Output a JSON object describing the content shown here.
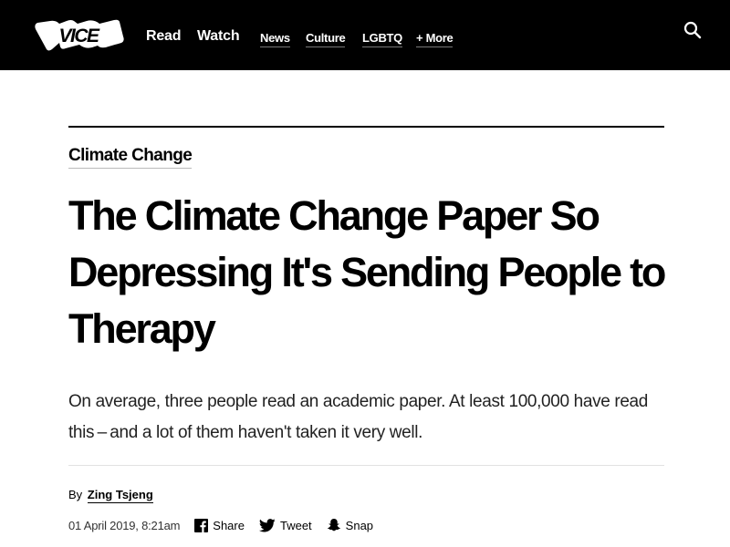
{
  "header": {
    "logo": "VICE",
    "nav_primary": [
      "Read",
      "Watch"
    ],
    "nav_secondary": [
      "News",
      "Culture",
      "LGBTQ",
      "+ More"
    ]
  },
  "article": {
    "category": "Climate Change",
    "title": "The Climate Change Paper So Depressing It's Sending People to Therapy",
    "dek": "On average, three people read an academic paper. At least 100,000 have read this – and a lot of them haven't taken it very well.",
    "byline_prefix": "By",
    "author": "Zing Tsjeng",
    "date": "01 April 2019, 8:21am",
    "share": {
      "facebook": "Share",
      "twitter": "Tweet",
      "snapchat": "Snap"
    }
  },
  "colors": {
    "header_bg": "#000000",
    "page_bg": "#ffffff",
    "text": "#000000"
  },
  "icons": [
    "search-icon",
    "facebook-icon",
    "twitter-icon",
    "snapchat-icon"
  ]
}
